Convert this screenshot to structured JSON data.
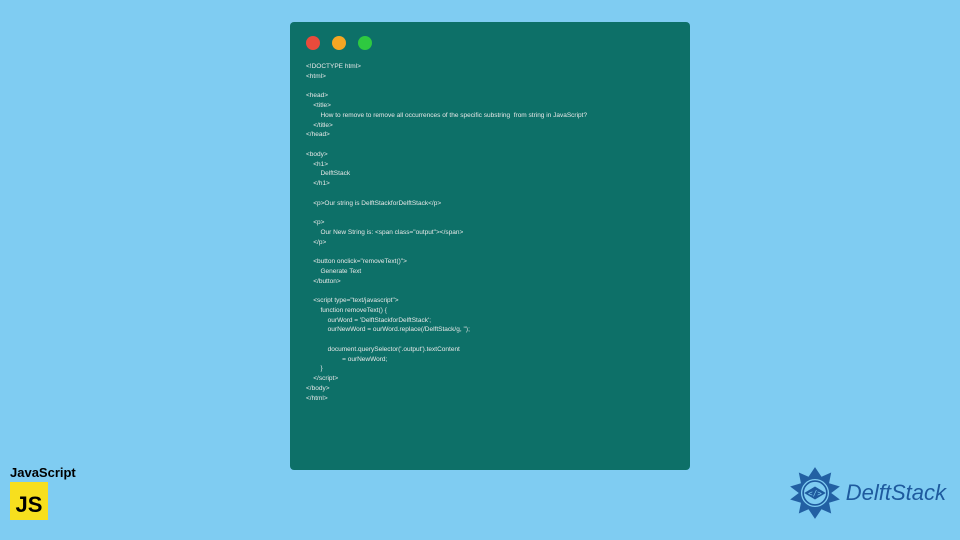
{
  "codeWindow": {
    "lines": "<!DOCTYPE html>\n<html>\n\n<head>\n    <title>\n        How to remove to remove all occurrences of the specific substring  from string in JavaScript?\n    </title>\n</head>\n\n<body>\n    <h1>\n        DelftStack\n    </h1>\n\n    <p>Our string is DelftStackforDelftStack</p>\n\n    <p>\n        Our New String is: <span class=\"output\"></span>\n    </p>\n\n    <button onclick=\"removeText()\">\n        Generate Text\n    </button>\n\n    <script type=\"text/javascript\">\n        function removeText() {\n            ourWord = 'DelftStackforDelftStack';\n            ourNewWord = ourWord.replace(/DelftStack/g, '');\n\n            document.querySelector('.output').textContent\n                    = ourNewWord;\n        }\n    </script>\n</body>\n</html>"
  },
  "jsBadge": {
    "label": "JavaScript",
    "logo": "JS"
  },
  "delft": {
    "brand": "DelftStack"
  }
}
